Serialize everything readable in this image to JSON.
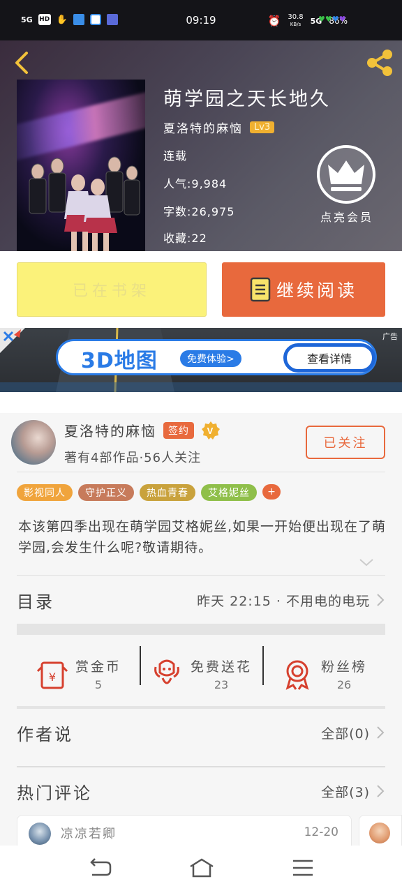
{
  "status_bar": {
    "network_left": "5G",
    "hd": "HD",
    "time": "09:19",
    "speed_value": "30.8",
    "speed_unit": "KB/s",
    "network_right": "5G",
    "battery": "86%"
  },
  "book": {
    "title": "萌学园之天长地久",
    "author": "夏洛特的麻恼",
    "author_level": "Lv3",
    "status": "连载",
    "popularity": "人气:9,984",
    "word_count": "字数:26,975",
    "favorites": "收藏:22",
    "vip_label": "点亮会员"
  },
  "actions": {
    "shelf_label": "已在书架",
    "read_label": "继续阅读"
  },
  "ad": {
    "headline": "3D地图",
    "try_label": "免费体验>",
    "detail_label": "查看详情",
    "ad_tag": "广告"
  },
  "author_panel": {
    "name": "夏洛特的麻恼",
    "sign_badge": "签约",
    "works_line": "著有4部作品·56人关注",
    "follow_label": "已关注"
  },
  "tags": [
    {
      "label": "影视同人",
      "color": "#f0a43c"
    },
    {
      "label": "守护正义",
      "color": "#c77b5b"
    },
    {
      "label": "热血青春",
      "color": "#c9a23c"
    },
    {
      "label": "艾格妮丝",
      "color": "#8fbf4a"
    }
  ],
  "tag_more": "+",
  "description": "本该第四季出现在萌学园艾格妮丝,如果一开始便出现在了萌学园,会发生什么呢?敬请期待。",
  "toc": {
    "label": "目录",
    "latest": "昨天 22:15 · 不用电的电玩"
  },
  "stats": [
    {
      "label": "赏金币",
      "value": "5",
      "icon": "red-envelope-icon"
    },
    {
      "label": "免费送花",
      "value": "23",
      "icon": "flower-icon"
    },
    {
      "label": "粉丝榜",
      "value": "26",
      "icon": "medal-icon"
    }
  ],
  "author_says": {
    "label": "作者说",
    "all": "全部(0)"
  },
  "hot_comments": {
    "label": "热门评论",
    "all": "全部(3)",
    "first_user": "凉凉若卿",
    "first_date": "12-20"
  },
  "colors": {
    "accent": "#e8693d",
    "shelf_button": "#fbf27a",
    "ad_blue": "#2a7be6"
  }
}
